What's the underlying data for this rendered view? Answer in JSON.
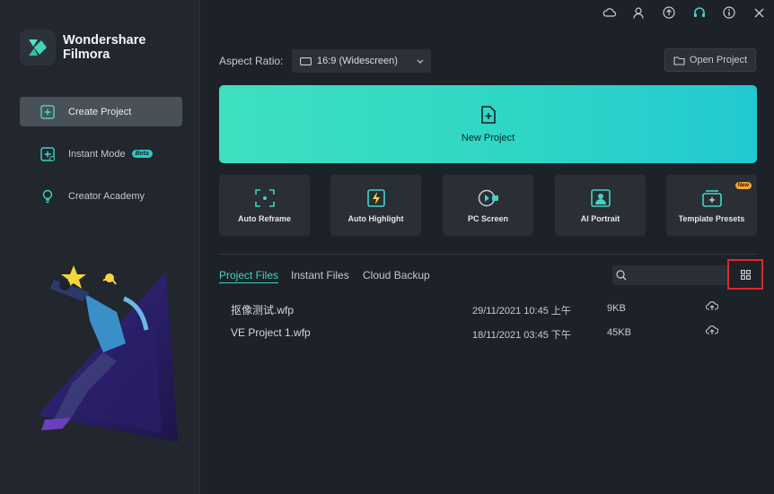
{
  "app": {
    "brand_line1": "Wondershare",
    "brand_line2": "Filmora"
  },
  "sidebar": {
    "items": [
      {
        "label": "Create Project",
        "icon": "create-project-icon",
        "active": true
      },
      {
        "label": "Instant Mode",
        "icon": "instant-mode-icon",
        "badge": "Beta"
      },
      {
        "label": "Creator Academy",
        "icon": "bulb-icon"
      }
    ]
  },
  "topbar": {
    "icons": [
      "cloud-icon",
      "user-icon",
      "upload-icon",
      "headset-icon",
      "info-icon",
      "close-icon"
    ]
  },
  "aspect": {
    "label": "Aspect Ratio:",
    "value": "16:9 (Widescreen)"
  },
  "open_project": {
    "label": "Open Project"
  },
  "new_project": {
    "label": "New Project"
  },
  "tiles": [
    {
      "label": "Auto Reframe",
      "icon": "auto-reframe-icon"
    },
    {
      "label": "Auto Highlight",
      "icon": "auto-highlight-icon"
    },
    {
      "label": "PC Screen",
      "icon": "pc-screen-icon"
    },
    {
      "label": "AI Portrait",
      "icon": "ai-portrait-icon"
    },
    {
      "label": "Template Presets",
      "icon": "template-presets-icon",
      "badge": "New"
    }
  ],
  "files": {
    "tabs": [
      "Project Files",
      "Instant Files",
      "Cloud Backup"
    ],
    "active_tab": "Project Files",
    "rows": [
      {
        "name": "抠像测试.wfp",
        "date": "29/11/2021 10:45 上午",
        "size": "9KB"
      },
      {
        "name": "VE Project 1.wfp",
        "date": "18/11/2021 03:45 下午",
        "size": "45KB"
      }
    ]
  },
  "colors": {
    "accent": "#3fd6c6",
    "highlight_box": "#e0262a",
    "background": "#1d2128",
    "sidebar": "#22262d"
  }
}
